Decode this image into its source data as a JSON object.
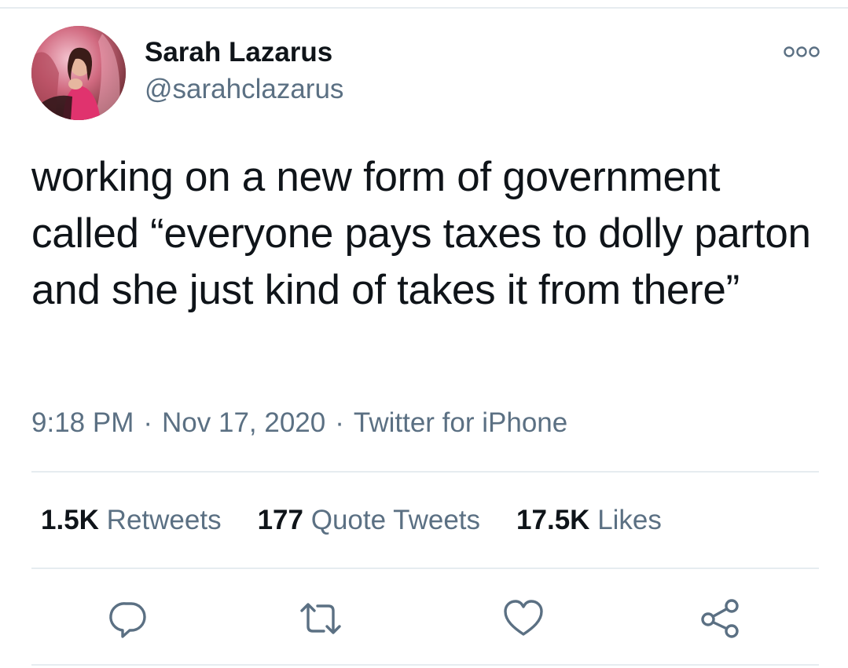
{
  "tweet": {
    "author": {
      "display_name": "Sarah Lazarus",
      "handle": "@sarahclazarus"
    },
    "text": "working on a new form of government called “everyone pays taxes to dolly parton and she just kind of takes it from there”",
    "time": "9:18 PM",
    "date": "Nov 17, 2020",
    "source": "Twitter for iPhone",
    "separator": "·"
  },
  "stats": {
    "retweets_count": "1.5K",
    "retweets_label": "Retweets",
    "quotes_count": "177",
    "quotes_label": "Quote Tweets",
    "likes_count": "17.5K",
    "likes_label": "Likes"
  },
  "icons": {
    "more": "more-options-icon",
    "reply": "reply-icon",
    "retweet": "retweet-icon",
    "like": "like-icon",
    "share": "share-icon"
  },
  "colors": {
    "text": "#0f1419",
    "secondary": "#5b7083",
    "divider": "#e6ecf0"
  }
}
